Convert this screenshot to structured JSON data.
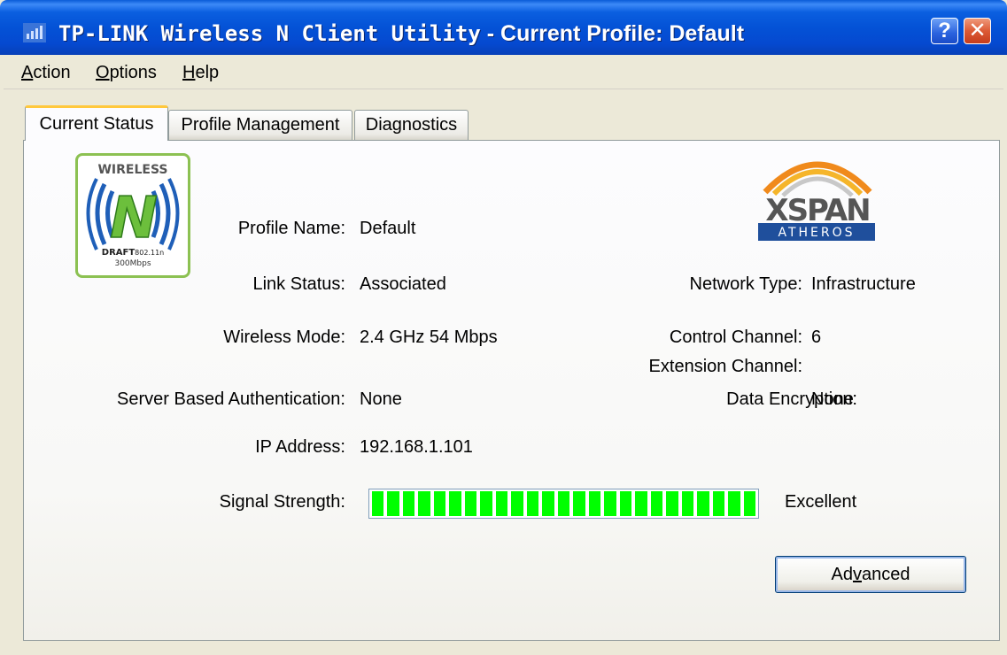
{
  "window": {
    "title_prefix": "TP-LINK Wireless N Client Utility",
    "title_suffix": " - Current Profile: Default",
    "help_button": "?",
    "close_button": "✕"
  },
  "menu": {
    "items": [
      {
        "first": "A",
        "rest": "ction"
      },
      {
        "first": "O",
        "rest": "ptions"
      },
      {
        "first": "H",
        "rest": "elp"
      }
    ]
  },
  "tabs": [
    {
      "label": "Current Status",
      "active": true
    },
    {
      "label": "Profile Management",
      "active": false
    },
    {
      "label": "Diagnostics",
      "active": false
    }
  ],
  "logos": {
    "wireless_n": {
      "top": "WIRELESS",
      "letter": "N",
      "draft": "DRAFT",
      "standard": "802.11n",
      "speed": "300Mbps"
    },
    "xspan": {
      "brand": "XSPAN",
      "vendor": "ATHEROS"
    }
  },
  "status": {
    "profile_name_label": "Profile Name:",
    "profile_name": "Default",
    "link_status_label": "Link Status:",
    "link_status": "Associated",
    "wireless_mode_label": "Wireless Mode:",
    "wireless_mode": "2.4 GHz 54 Mbps",
    "server_auth_label": "Server Based Authentication:",
    "server_auth": "None",
    "ip_address_label": "IP Address:",
    "ip_address": "192.168.1.101",
    "signal_strength_label": "Signal Strength:",
    "signal_strength_text": "Excellent",
    "signal_strength_fraction": 1.0,
    "network_type_label": "Network Type:",
    "network_type": "Infrastructure",
    "control_channel_label": "Control Channel:",
    "control_channel": "6",
    "extension_channel_label": "Extension Channel:",
    "extension_channel": "",
    "data_encryption_label": "Data Encryption:",
    "data_encryption": "None"
  },
  "buttons": {
    "advanced_first": "Ad",
    "advanced_underlined": "v",
    "advanced_rest": "anced"
  },
  "colors": {
    "signal": "#00ff00",
    "titlebar": "#0452d6",
    "active_tab_accent": "#ffc83c"
  }
}
